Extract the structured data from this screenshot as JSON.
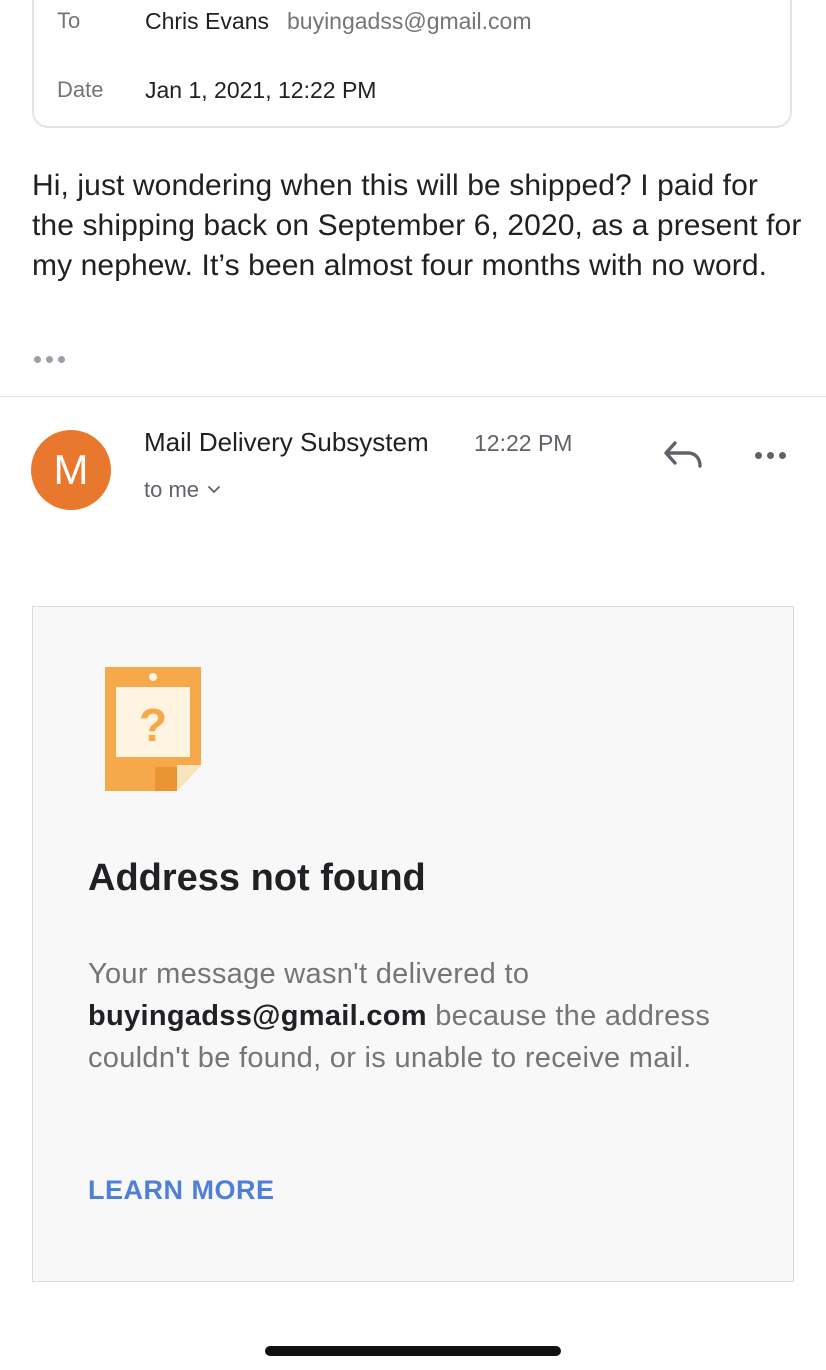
{
  "message_details": {
    "to_label": "To",
    "to_name": "Chris Evans",
    "to_email": "buyingadss@gmail.com",
    "date_label": "Date",
    "date_value": "Jan 1, 2021, 12:22 PM"
  },
  "original_message": {
    "body": "Hi, just wondering when this will be shipped? I paid for the shipping back on September 6, 2020, as a present for my nephew. It’s been almost four months with no word."
  },
  "reply_message": {
    "avatar_letter": "M",
    "avatar_color": "#e8782e",
    "sender": "Mail Delivery Subsystem",
    "time": "12:22 PM",
    "recipient": "to me",
    "icons": [
      "reply-icon",
      "more-options-icon",
      "chevron-down-icon"
    ]
  },
  "bounce_notice": {
    "icon": "question-note-icon",
    "title": "Address not found",
    "message_prefix": "Your message wasn't delivered to",
    "email": "buyingadss@gmail.com",
    "message_suffix": "because the address couldn't be found, or is unable to receive mail.",
    "learn_more": "LEARN MORE",
    "link_color": "#4f7fd6"
  }
}
